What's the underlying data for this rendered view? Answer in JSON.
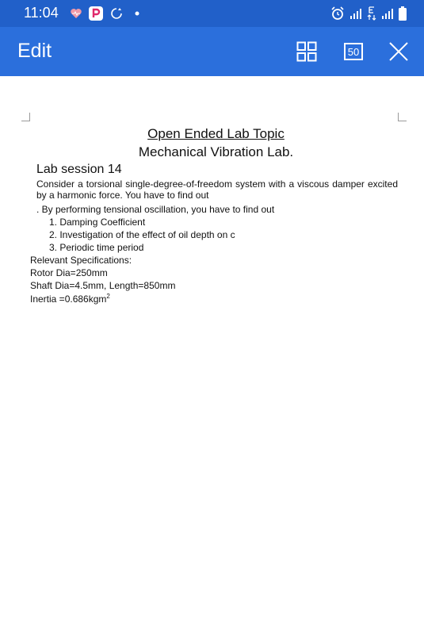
{
  "status_bar": {
    "time": "11:04",
    "bg_color": "#2160c9"
  },
  "app_bar": {
    "title": "Edit",
    "zoom_label": "50",
    "bg_color": "#2b6fdc",
    "icons": [
      "grid-layout-icon",
      "zoom-level-icon",
      "close-icon"
    ]
  },
  "document": {
    "title_line_1": "Open Ended Lab Topic",
    "title_line_2": "Mechanical Vibration Lab.",
    "session": "Lab session 14",
    "paragraph": "Consider a torsional single-degree-of-freedom system with a viscous damper excited by a harmonic force. You have to find out",
    "intro_line": ". By performing tensional oscillation, you have to find out",
    "list_items": [
      "1. Damping Coefficient",
      "2. Investigation of the effect of oil depth on c",
      "3. Periodic time period"
    ],
    "spec_heading": "Relevant Specifications:",
    "rotor": "Rotor Dia=250mm",
    "shaft": "Shaft Dia=4.5mm, Length=850mm",
    "inertia_prefix": "Inertia =0.686kgm",
    "inertia_exponent": "2"
  }
}
